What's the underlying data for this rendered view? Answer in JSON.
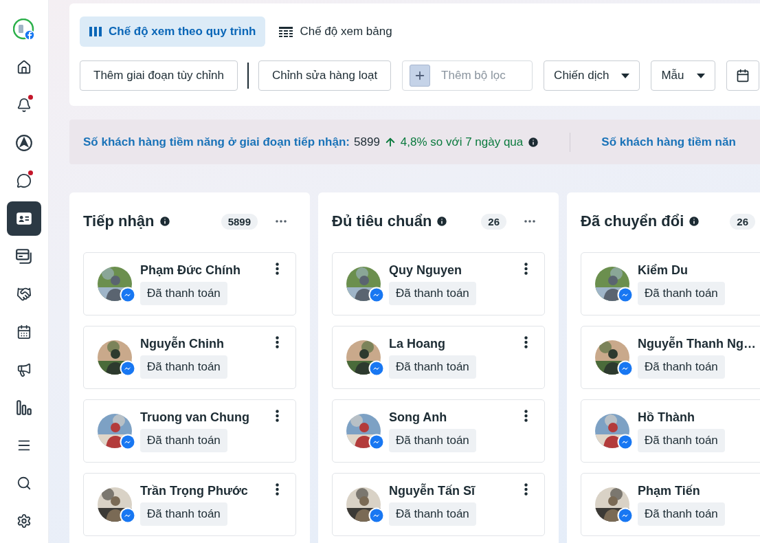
{
  "sidebar": {
    "items": [
      {
        "selected": false,
        "notification": false
      },
      {
        "selected": false,
        "notification": false
      },
      {
        "selected": false,
        "notification": true
      },
      {
        "selected": false,
        "notification": false
      },
      {
        "selected": false,
        "notification": true
      },
      {
        "selected": true,
        "notification": false
      },
      {
        "selected": false,
        "notification": false
      },
      {
        "selected": false,
        "notification": false
      },
      {
        "selected": false,
        "notification": false
      },
      {
        "selected": false,
        "notification": false
      },
      {
        "selected": false,
        "notification": false
      },
      {
        "selected": false,
        "notification": false
      },
      {
        "selected": false,
        "notification": false
      },
      {
        "selected": false,
        "notification": false
      }
    ]
  },
  "tabs": [
    {
      "label": "Chế độ xem theo quy trình",
      "selected": true
    },
    {
      "label": "Chế độ xem bảng",
      "selected": false
    }
  ],
  "toolbar": {
    "buttons": [
      "Thêm giai đoạn tùy chỉnh",
      "Chỉnh sửa hàng loạt"
    ],
    "filter": {
      "placeholder": "Thêm bộ lọc"
    },
    "dropdowns": [
      "Chiến dịch",
      "Mẫu"
    ]
  },
  "stats": [
    {
      "label": "Số khách hàng tiềm năng ở giai đoạn tiếp nhận:",
      "value": "5899",
      "change": "4,8%",
      "comparison": "so với 7 ngày qua"
    },
    {
      "label": "Số khách hàng tiềm năn"
    }
  ],
  "columns": [
    {
      "title": "Tiếp nhận",
      "count": "5899",
      "cards": [
        {
          "name": "Phạm Đức Chính",
          "tag": "Đã thanh toán"
        },
        {
          "name": "Nguyễn Chinh",
          "tag": "Đã thanh toán"
        },
        {
          "name": "Truong van Chung",
          "tag": "Đã thanh toán"
        },
        {
          "name": "Trần Trọng Phước",
          "tag": "Đã thanh toán"
        }
      ]
    },
    {
      "title": "Đủ tiêu chuẩn",
      "count": "26",
      "cards": [
        {
          "name": "Quy Nguyen",
          "tag": "Đã thanh toán"
        },
        {
          "name": "La Hoang",
          "tag": "Đã thanh toán"
        },
        {
          "name": "Song Anh",
          "tag": "Đã thanh toán"
        },
        {
          "name": "Nguyễn Tấn Sĩ",
          "tag": "Đã thanh toán"
        }
      ]
    },
    {
      "title": "Đã chuyển đổi",
      "count": "26",
      "cards": [
        {
          "name": "Kiểm Du",
          "tag": "Đã thanh toán"
        },
        {
          "name": "Nguyễn Thanh Ng…",
          "tag": "Đã thanh toán"
        },
        {
          "name": "Hồ Thành",
          "tag": "Đã thanh toán"
        },
        {
          "name": "Phạm Tiến",
          "tag": "Đã thanh toán"
        }
      ]
    }
  ]
}
